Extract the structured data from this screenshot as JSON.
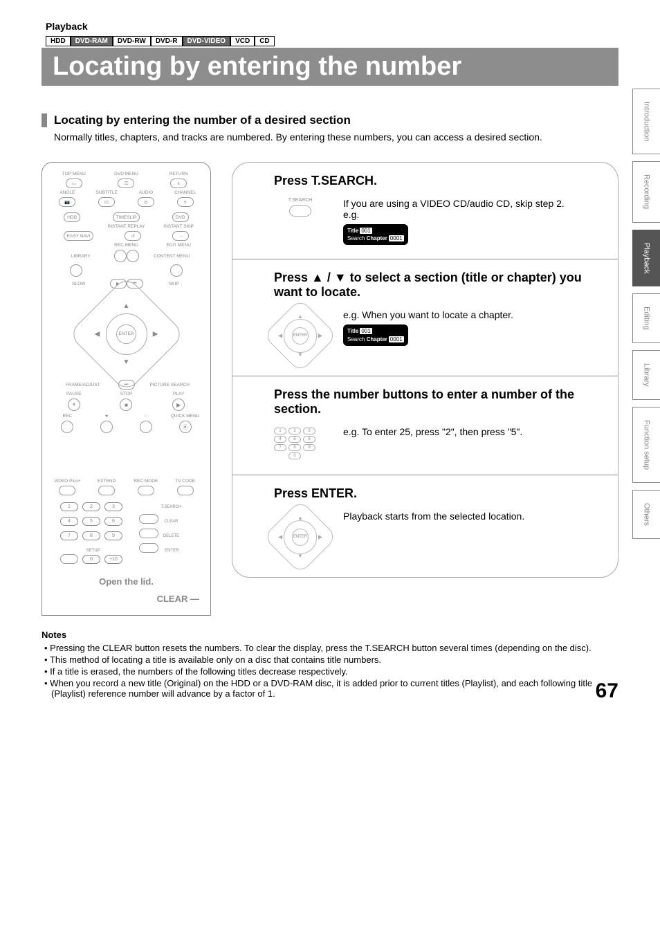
{
  "section": "Playback",
  "media_tags": [
    "HDD",
    "DVD-RAM",
    "DVD-RW",
    "DVD-R",
    "DVD-VIDEO",
    "VCD",
    "CD"
  ],
  "media_tags_dark": [
    false,
    true,
    false,
    false,
    true,
    false,
    false
  ],
  "title": "Locating by entering the number",
  "subhead": "Locating by entering the number of a desired section",
  "intro": "Normally titles, chapters, and tracks are numbered. By entering these numbers, you can access a desired section.",
  "remote": {
    "top_labels": [
      "TOP MENU",
      "DVD MENU",
      "RETURN"
    ],
    "row2_labels": [
      "ANGLE",
      "SUBTITLE",
      "AUDIO",
      "CHANNEL"
    ],
    "row3": [
      "HDD",
      "TIMESLIP",
      "DVD"
    ],
    "row4_sub": [
      "INSTANT REPLAY",
      "INSTANT SKIP"
    ],
    "row4": [
      "EASY NAVI",
      "",
      "→"
    ],
    "row5_sub": [
      "REC MENU",
      "EDIT MENU"
    ],
    "library": "LIBRARY",
    "content": "CONTENT MENU",
    "slow": "SLOW",
    "skip": "SKIP",
    "enter": "ENTER",
    "frame": "FRAME/ADJUST",
    "picture": "PICTURE SEARCH",
    "pause": "PAUSE",
    "stop": "STOP",
    "play": "PLAY",
    "rec": "REC",
    "quick": "QUICK MENU",
    "vplus": "VIDEO Plus+",
    "extend": "EXTEND",
    "recmode": "REC MODE",
    "tvcode": "TV CODE",
    "tsearch": "T.SEARCH",
    "clear_small": "CLEAR",
    "delete": "DELETE",
    "setup": "SETUP",
    "enter2": "ENTER",
    "plus10": "+10",
    "open_lid": "Open the lid.",
    "clear": "CLEAR"
  },
  "steps": [
    {
      "head": "Press T.SEARCH.",
      "graphic_label": "T.SEARCH",
      "text1": "If you are using a VIDEO CD/audio CD, skip step 2.",
      "text2": "e.g.",
      "osd_title": "Title",
      "osd_title_val": "001",
      "osd_search": "Search",
      "osd_chapter": "Chapter",
      "osd_chapter_val": "0001"
    },
    {
      "head": "Press ▲ / ▼ to select a section (title or chapter) you want to locate.",
      "text1": "e.g. When you want to locate a chapter.",
      "osd_title": "Title",
      "osd_title_val": "001",
      "osd_search": "Search",
      "osd_chapter": "Chapter",
      "osd_chapter_val": "0001"
    },
    {
      "head": "Press the number buttons to enter a number of the section.",
      "text1": "e.g. To enter 25, press \"2\", then press \"5\"."
    },
    {
      "head": "Press ENTER.",
      "text1": "Playback starts from the selected location.",
      "center_label": "ENTER"
    }
  ],
  "notes_head": "Notes",
  "notes": [
    "Pressing the CLEAR button resets the numbers. To clear the display, press the T.SEARCH button several times (depending on the disc).",
    "This method of locating a title is available only on a disc that contains title numbers.",
    "If a title is erased, the numbers of the following titles decrease respectively.",
    "When you record a new title (Original) on the HDD or a DVD-RAM disc, it is added prior to current titles (Playlist), and each following title (Playlist) reference number will advance by a factor of 1."
  ],
  "side_tabs": [
    "Introduction",
    "Recording",
    "Playback",
    "Editing",
    "Library",
    "Function setup",
    "Others"
  ],
  "active_tab": "Playback",
  "page_number": "67"
}
